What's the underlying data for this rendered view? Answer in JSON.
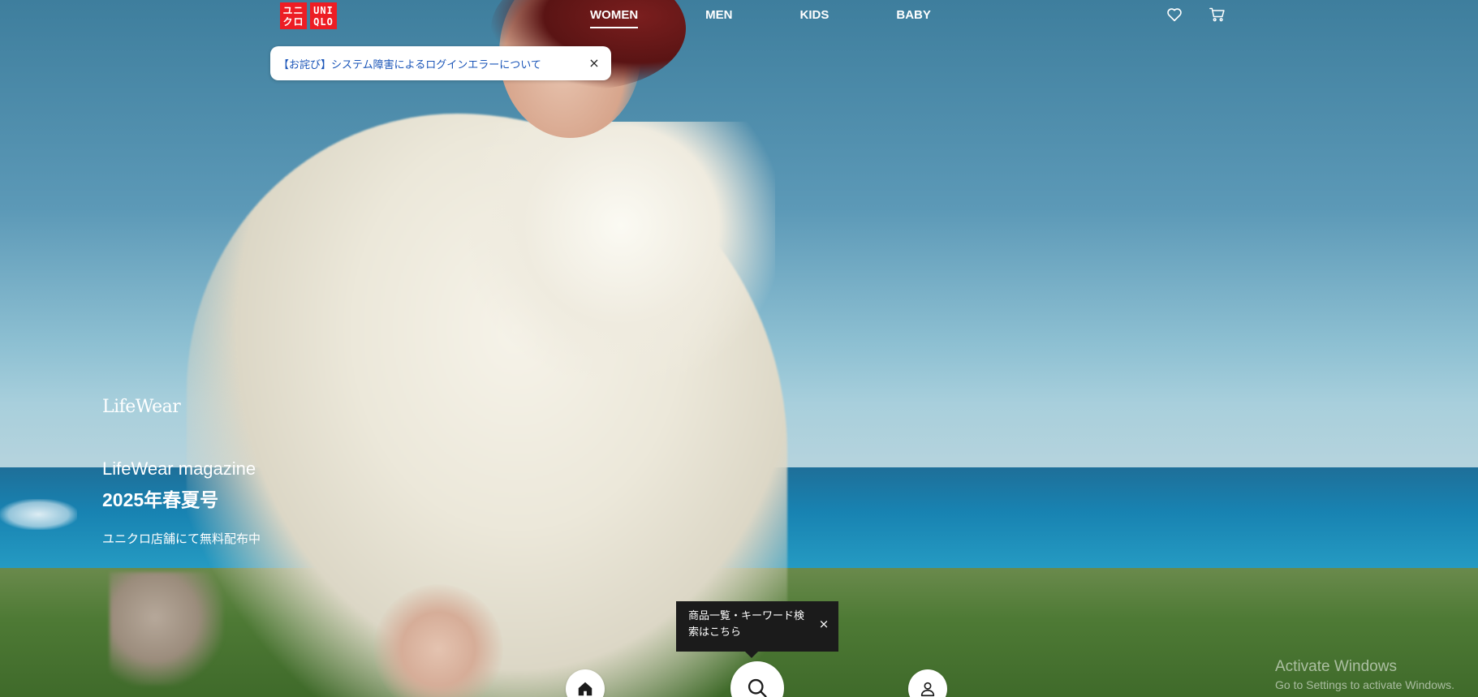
{
  "brand": {
    "logo_top": [
      "ユニ",
      "クロ"
    ],
    "logo_bottom": [
      "UNI",
      "QLO"
    ],
    "red": "#ed1d24"
  },
  "nav": {
    "items": [
      {
        "label": "WOMEN",
        "active": true
      },
      {
        "label": "MEN",
        "active": false
      },
      {
        "label": "KIDS",
        "active": false
      },
      {
        "label": "BABY",
        "active": false
      }
    ]
  },
  "header_icons": {
    "favorites": "heart-icon",
    "cart": "cart-icon"
  },
  "notice": {
    "text": "【お詫び】システム障害によるログインエラーについて",
    "close": "×",
    "link_color": "#1a55b8"
  },
  "hero": {
    "logo_text": "LifeWear",
    "title": "LifeWear magazine",
    "issue": "2025年春夏号",
    "subtitle": "ユニクロ店舗にて無料配布中"
  },
  "tooltip": {
    "text": "商品一覧・キーワード検索はこちら",
    "close": "×"
  },
  "bottom_nav": {
    "home": "home-icon",
    "search": "search-icon",
    "account": "account-icon"
  },
  "watermark": {
    "title": "Activate Windows",
    "subtitle": "Go to Settings to activate Windows."
  }
}
